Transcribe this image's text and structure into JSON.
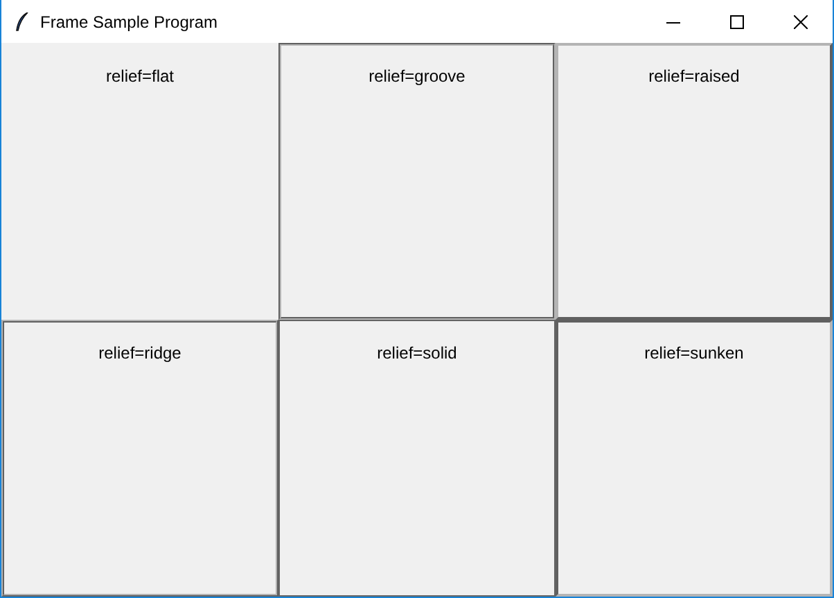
{
  "window": {
    "title": "Frame Sample Program"
  },
  "frames": [
    {
      "kind": "flat",
      "label": "relief=flat"
    },
    {
      "kind": "groove",
      "label": "relief=groove"
    },
    {
      "kind": "raised",
      "label": "relief=raised"
    },
    {
      "kind": "ridge",
      "label": "relief=ridge"
    },
    {
      "kind": "solid",
      "label": "relief=solid"
    },
    {
      "kind": "sunken",
      "label": "relief=sunken"
    }
  ]
}
